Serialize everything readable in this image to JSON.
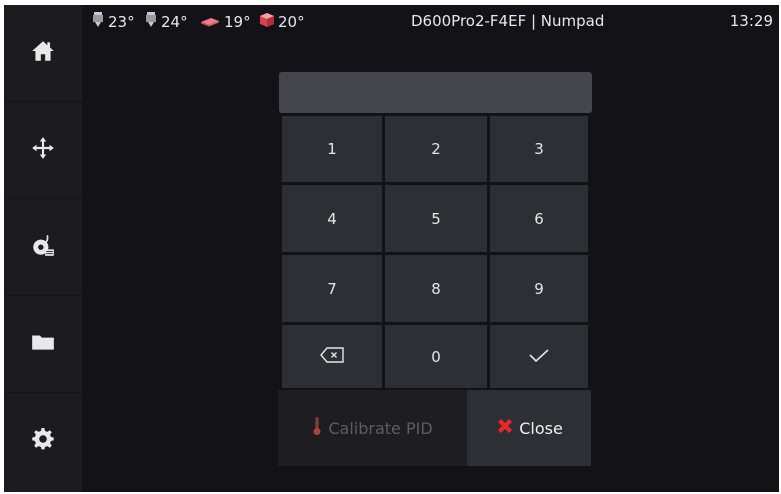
{
  "topbar": {
    "temps": [
      {
        "icon": "extruder-icon",
        "value": "23°"
      },
      {
        "icon": "extruder-icon",
        "value": "24°"
      },
      {
        "icon": "heated-bed-icon",
        "value": "19°"
      },
      {
        "icon": "chamber-icon",
        "value": "20°"
      }
    ],
    "title": "D600Pro2-F4EF | Numpad",
    "clock": "13:29"
  },
  "sidebar": {
    "items": [
      {
        "icon": "home-icon"
      },
      {
        "icon": "move-icon"
      },
      {
        "icon": "extrude-icon"
      },
      {
        "icon": "folder-icon"
      },
      {
        "icon": "gear-icon"
      }
    ]
  },
  "entry": {
    "value": ""
  },
  "keypad": {
    "keys": [
      "1",
      "2",
      "3",
      "4",
      "5",
      "6",
      "7",
      "8",
      "9",
      "backspace-icon",
      "0",
      "checkmark-icon"
    ]
  },
  "actions": {
    "calibrate_label": "Calibrate PID",
    "close_label": "Close"
  },
  "colors": {
    "background": "#121217",
    "sidebar": "#1b1b20",
    "key": "#2e2e35",
    "close_x": "#e8262b",
    "thermometer": "#d9534f"
  }
}
